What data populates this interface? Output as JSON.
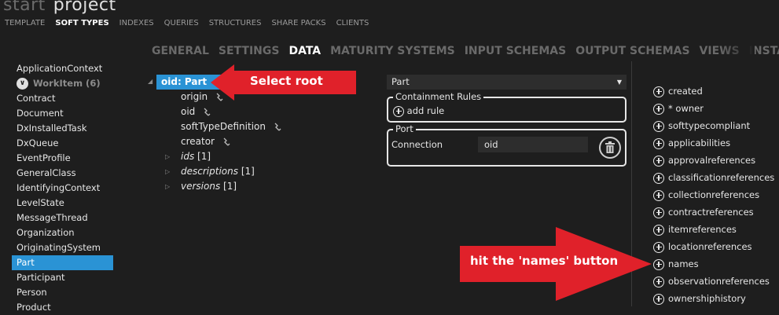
{
  "app": {
    "title_dim": "start",
    "title": "project"
  },
  "topnav": [
    "TEMPLATE",
    "SOFT TYPES",
    "INDEXES",
    "QUERIES",
    "STRUCTURES",
    "SHARE PACKS",
    "CLIENTS"
  ],
  "subtabs": [
    "GENERAL",
    "SETTINGS",
    "DATA",
    "MATURITY SYSTEMS",
    "INPUT SCHEMAS",
    "OUTPUT SCHEMAS",
    "VIEWS",
    "INSTANC"
  ],
  "sidebar": {
    "items": [
      "ApplicationContext"
    ],
    "group": {
      "label": "WorkItem (6)"
    },
    "items_after": [
      "Contract",
      "Document",
      "DxInstalledTask",
      "DxQueue",
      "EventProfile",
      "GeneralClass",
      "IdentifyingContext",
      "LevelState",
      "MessageThread",
      "Organization",
      "OriginatingSystem",
      "Part",
      "Participant",
      "Person",
      "Product"
    ],
    "selected": "Part"
  },
  "tree": {
    "root": {
      "label": "oid:  Part"
    },
    "children": [
      {
        "label": "origin"
      },
      {
        "label": "oid"
      },
      {
        "label": "softTypeDefinition"
      },
      {
        "label": "creator"
      }
    ],
    "collections": [
      {
        "label": "ids",
        "count": "[1]"
      },
      {
        "label": "descriptions",
        "count": "[1]"
      },
      {
        "label": "versions",
        "count": "[1]"
      }
    ]
  },
  "callouts": {
    "select_root": "Select root",
    "names": "hit the 'names' button"
  },
  "editor": {
    "type_select": "Part",
    "containment": {
      "legend": "Containment Rules",
      "add_rule": "add rule"
    },
    "port": {
      "legend": "Port",
      "connection_label": "Connection",
      "connection_value": "oid"
    }
  },
  "properties": [
    "created",
    "* owner",
    "softtypecompliant",
    "applicabilities",
    "approvalreferences",
    "classificationreferences",
    "collectionreferences",
    "contractreferences",
    "itemreferences",
    "locationreferences",
    "names",
    "observationreferences",
    "ownershiphistory"
  ],
  "colors": {
    "accent": "#2a93d5",
    "callout": "#e0212a",
    "background": "#1e1e1e"
  }
}
